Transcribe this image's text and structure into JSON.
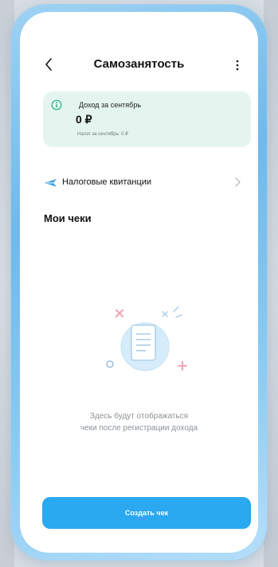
{
  "header": {
    "back_icon": "chevron-left-icon",
    "title": "Самозанятость",
    "more_icon": "more-vertical-icon"
  },
  "income_card": {
    "icon": "info-icon",
    "label": "Доход за сентябрь",
    "amount": "0 ₽",
    "tax_line": "Налог за сентябрь: 0 ₽"
  },
  "receipts_row": {
    "icon": "paper-plane-icon",
    "label": "Налоговые квитанции",
    "chevron": "chevron-right-icon"
  },
  "checks_section": {
    "title": "Мои чеки",
    "empty_text_line1": "Здесь будут отображаться",
    "empty_text_line2": "чеки после регистрации дохода",
    "illustration": "receipt-illustration-icon"
  },
  "create_button": {
    "label": "Создать чек"
  },
  "colors": {
    "accent": "#2aa8f0",
    "card_bg": "#e4f5ef",
    "info_icon": "#22b27a",
    "frame": "#7dbfed"
  }
}
